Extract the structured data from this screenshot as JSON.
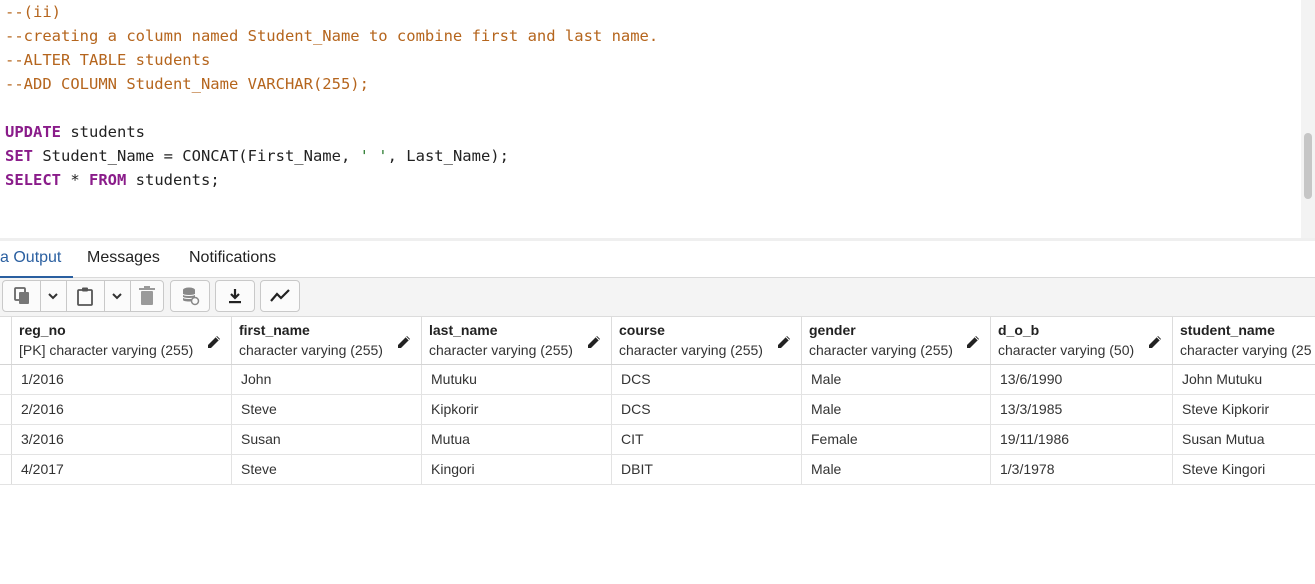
{
  "editor": {
    "lines": [
      [
        {
          "t": "--(ii)",
          "c": "cmt"
        }
      ],
      [
        {
          "t": "--creating a column named Student_Name to combine first and last name.",
          "c": "cmt"
        }
      ],
      [
        {
          "t": "--ALTER TABLE students",
          "c": "cmt"
        }
      ],
      [
        {
          "t": "--ADD COLUMN Student_Name VARCHAR(255);",
          "c": "cmt"
        }
      ],
      [],
      [
        {
          "t": "UPDATE",
          "c": "kw"
        },
        {
          "t": " students",
          "c": "pl"
        }
      ],
      [
        {
          "t": "SET",
          "c": "kw"
        },
        {
          "t": " Student_Name = CONCAT(First_Name, ",
          "c": "pl"
        },
        {
          "t": "' '",
          "c": "st"
        },
        {
          "t": ", Last_Name);",
          "c": "pl"
        }
      ],
      [
        {
          "t": "SELECT",
          "c": "kw"
        },
        {
          "t": " * ",
          "c": "pl"
        },
        {
          "t": "FROM",
          "c": "kw"
        },
        {
          "t": " students;",
          "c": "pl"
        }
      ]
    ]
  },
  "tabs": [
    {
      "label": "a Output",
      "active": true
    },
    {
      "label": "Messages",
      "active": false
    },
    {
      "label": "Notifications",
      "active": false
    }
  ],
  "toolbar": {
    "buttons": [
      "copy-icon",
      "chevron-down-icon",
      "paste-icon",
      "chevron-down-icon",
      "delete-icon",
      "save-data-icon",
      "download-icon",
      "graph-icon"
    ]
  },
  "grid": {
    "columns": [
      {
        "name": "reg_no",
        "type": "[PK] character varying (255)"
      },
      {
        "name": "first_name",
        "type": "character varying (255)"
      },
      {
        "name": "last_name",
        "type": "character varying (255)"
      },
      {
        "name": "course",
        "type": "character varying (255)"
      },
      {
        "name": "gender",
        "type": "character varying (255)"
      },
      {
        "name": "d_o_b",
        "type": "character varying (50)"
      },
      {
        "name": "student_name",
        "type": "character varying (25"
      }
    ],
    "rows": [
      [
        "1/2016",
        "John",
        "Mutuku",
        "DCS",
        "Male",
        "13/6/1990",
        "John Mutuku"
      ],
      [
        "2/2016",
        "Steve",
        "Kipkorir",
        "DCS",
        "Male",
        "13/3/1985",
        "Steve Kipkorir"
      ],
      [
        "3/2016",
        "Susan",
        "Mutua",
        "CIT",
        "Female",
        "19/11/1986",
        "Susan Mutua"
      ],
      [
        "4/2017",
        "Steve",
        "Kingori",
        "DBIT",
        "Male",
        "1/3/1978",
        "Steve Kingori"
      ]
    ]
  }
}
